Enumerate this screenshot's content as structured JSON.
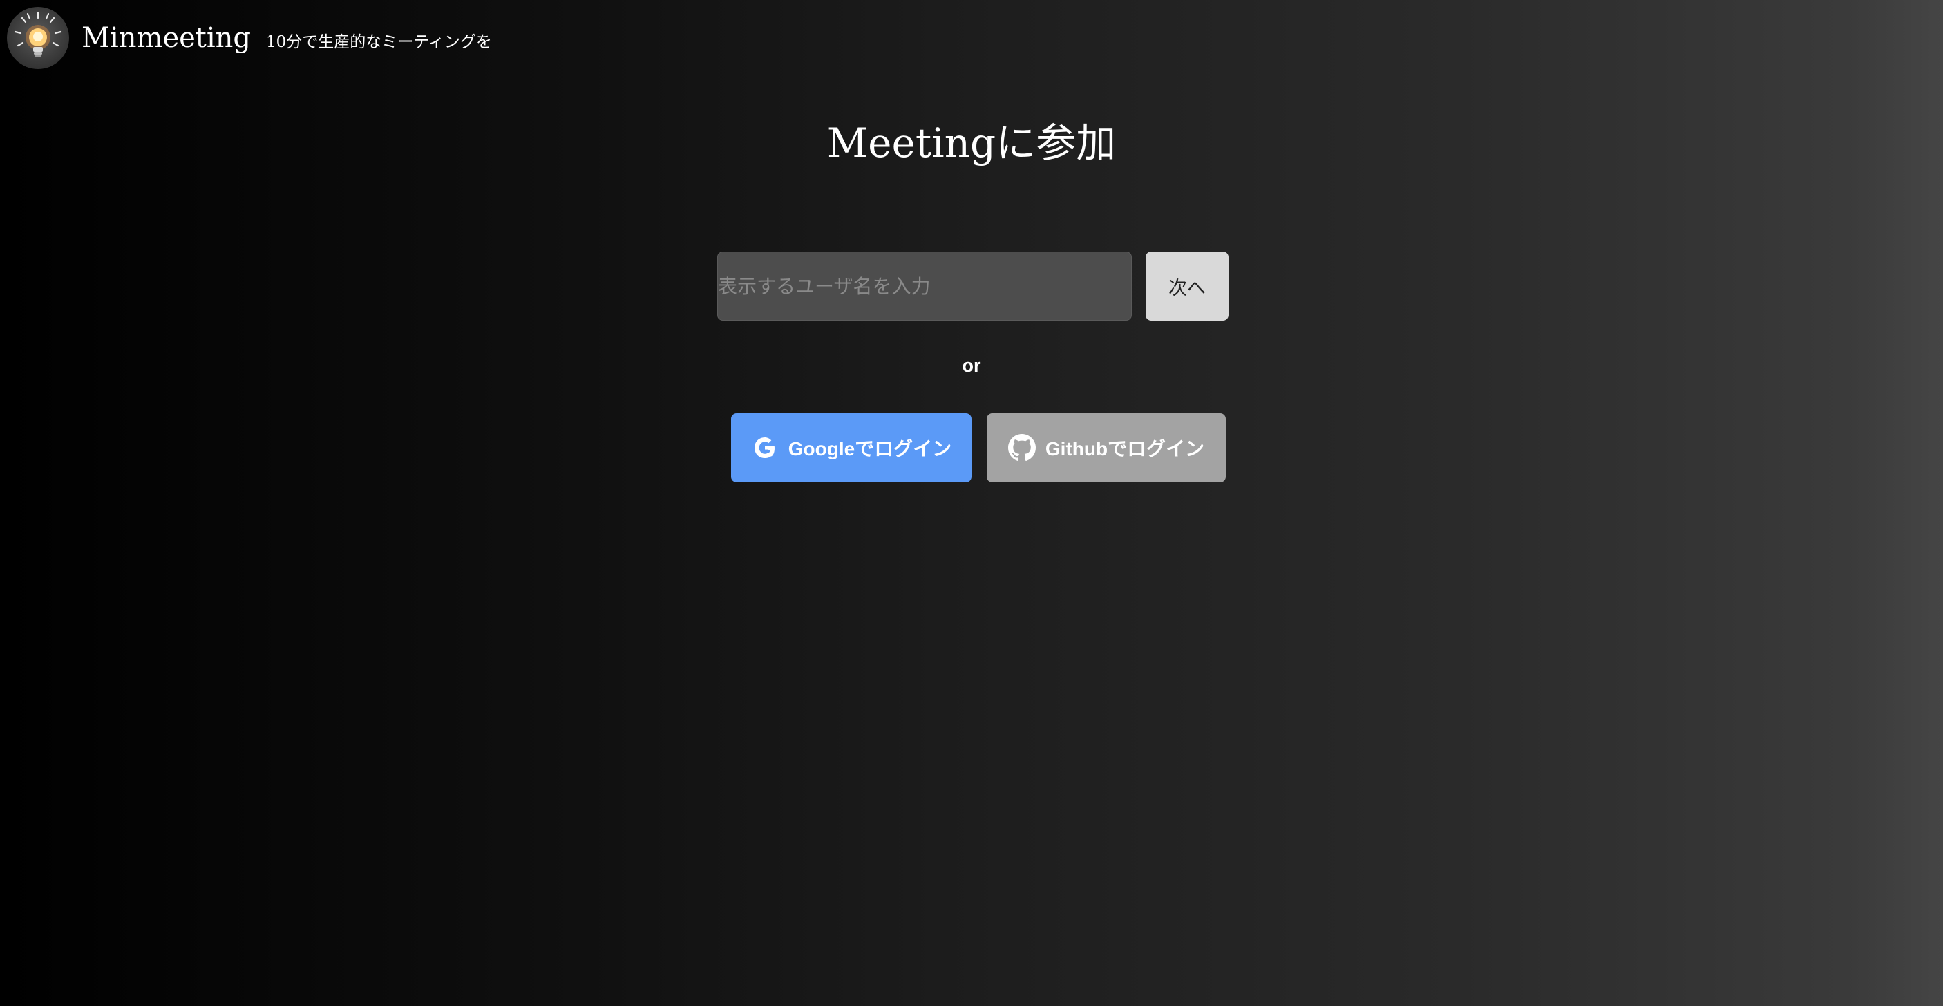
{
  "header": {
    "brand": "Minmeeting",
    "tagline": "10分で生産的なミーティングを",
    "logo_icon": "lightbulb-icon"
  },
  "main": {
    "title": "Meetingに参加",
    "username_placeholder": "表示するユーザ名を入力",
    "username_value": "",
    "next_label": "次へ",
    "or_label": "or",
    "google_label": "Googleでログイン",
    "google_icon": "google-icon",
    "github_label": "Githubでログイン",
    "github_icon": "github-icon"
  },
  "colors": {
    "google_button": "#5b9af7",
    "github_button": "#a3a3a3",
    "next_button": "#d9d9d9",
    "input_background": "#4d4d4d"
  }
}
